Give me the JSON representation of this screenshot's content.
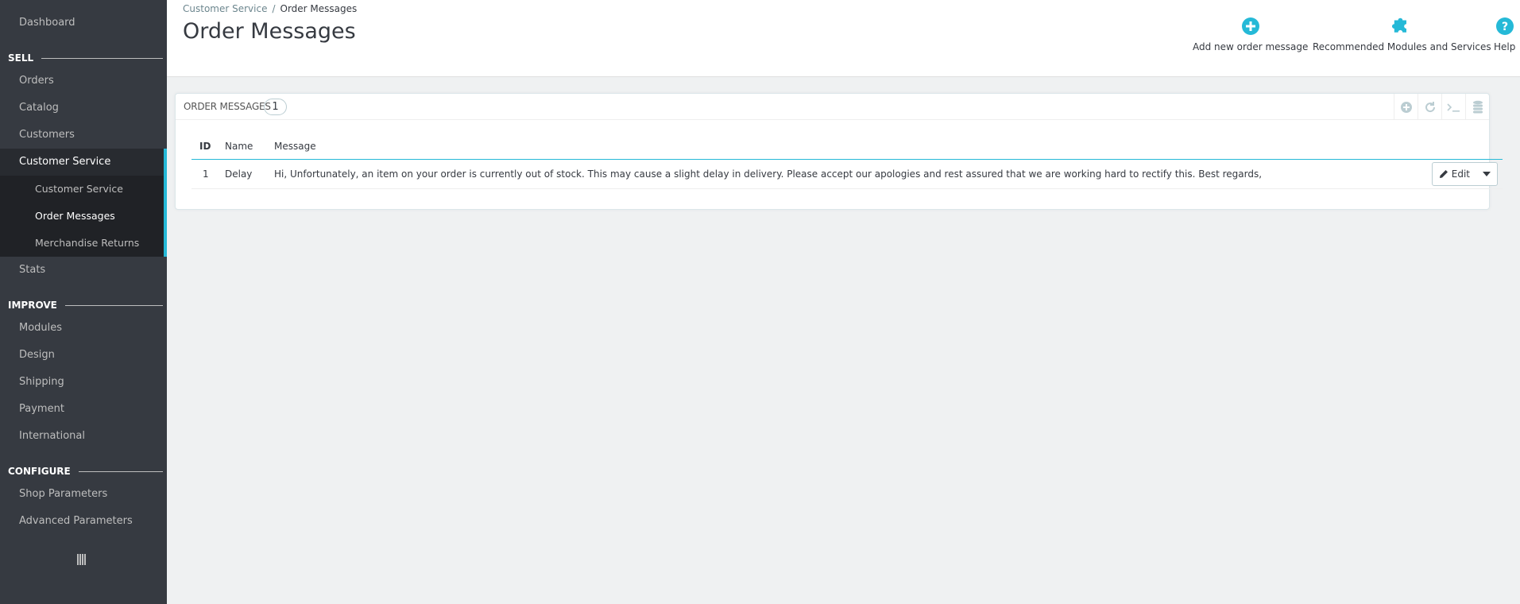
{
  "sidebar": {
    "dashboard": "Dashboard",
    "sections": {
      "sell": "SELL",
      "improve": "IMPROVE",
      "configure": "CONFIGURE"
    },
    "items": {
      "orders": "Orders",
      "catalog": "Catalog",
      "customers": "Customers",
      "customer_service": "Customer Service",
      "stats": "Stats",
      "modules": "Modules",
      "design": "Design",
      "shipping": "Shipping",
      "payment": "Payment",
      "international": "International",
      "shop_parameters": "Shop Parameters",
      "advanced_parameters": "Advanced Parameters"
    },
    "sub_items": {
      "customer_service": "Customer Service",
      "order_messages": "Order Messages",
      "merchandise_returns": "Merchandise Returns"
    }
  },
  "header": {
    "breadcrumb": [
      "Customer Service",
      "Order Messages"
    ],
    "breadcrumb_sep": "/",
    "title": "Order Messages",
    "toolbar": {
      "add": "Add new order message",
      "recommended": "Recommended Modules and Services",
      "help": "Help"
    }
  },
  "panel": {
    "title": "ORDER MESSAGES",
    "count": "1",
    "columns": {
      "id": "ID",
      "name": "Name",
      "message": "Message"
    },
    "rows": [
      {
        "id": "1",
        "name": "Delay",
        "message": "Hi, Unfortunately, an item on your order is currently out of stock. This may cause a slight delay in delivery. Please accept our apologies and rest assured that we are working hard to rectify this. Best regards,",
        "edit_label": "Edit"
      }
    ]
  },
  "colors": {
    "accent": "#25b9d7",
    "sidebar_bg": "#363a41",
    "page_bg": "#eff1f2"
  },
  "icons": {
    "add": "plus-circle-icon",
    "recommended": "puzzle-icon",
    "help": "question-circle-icon",
    "edit": "pencil-icon"
  }
}
